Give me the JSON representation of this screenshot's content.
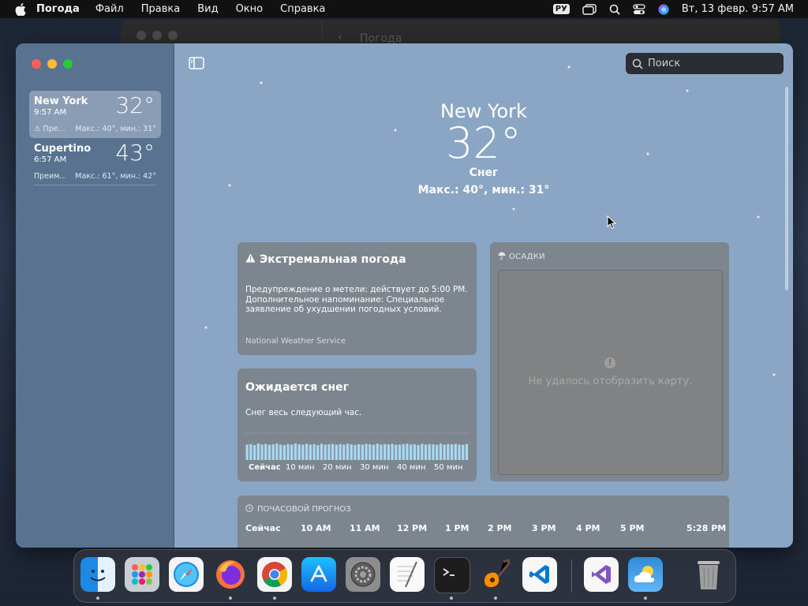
{
  "menubar": {
    "app_name": "Погода",
    "items": [
      "Файл",
      "Правка",
      "Вид",
      "Окно",
      "Справка"
    ],
    "keyboard_layout": "РУ",
    "clock": "Вт, 13 февр.  9:57 AM"
  },
  "background_window": {
    "title": "Погода"
  },
  "search": {
    "placeholder": "Поиск"
  },
  "sidebar": {
    "cities": [
      {
        "name": "New York",
        "time": "9:57 AM",
        "temp": "32°",
        "condition": "Пре...",
        "range": "Макс.: 40°, мин.: 31°",
        "selected": true,
        "alert": true
      },
      {
        "name": "Cupertino",
        "time": "6:57 AM",
        "temp": "43°",
        "condition": "Преим...",
        "range": "Макс.: 61°, мин.: 42°",
        "selected": false,
        "alert": false
      }
    ]
  },
  "current": {
    "city": "New York",
    "temp": "32°",
    "condition": "Снег",
    "hilo": "Макс.: 40°, мин.: 31°"
  },
  "alert_card": {
    "title": "Экстремальная погода",
    "body": "Предупреждение о метели: действует до 5:00 PM. Дополнительное напоминание: Специальное заявление об ухудшении погодных условий.",
    "source": "National Weather Service"
  },
  "snow_card": {
    "title": "Ожидается снег",
    "body": "Снег весь следующий час.",
    "axis": [
      "Сейчас",
      "10 мин",
      "20 мин",
      "30 мин",
      "40 мин",
      "50 мин"
    ],
    "intensity": [
      0.7,
      0.72,
      0.68,
      0.75,
      0.7,
      0.73,
      0.69,
      0.71,
      0.74,
      0.7,
      0.68,
      0.72,
      0.7,
      0.75,
      0.71,
      0.69,
      0.73,
      0.7,
      0.72,
      0.68,
      0.74,
      0.7,
      0.71,
      0.73,
      0.69,
      0.72,
      0.7,
      0.74,
      0.71,
      0.68,
      0.72,
      0.7,
      0.73,
      0.71,
      0.69,
      0.74,
      0.7,
      0.72,
      0.71,
      0.73,
      0.69,
      0.7,
      0.72,
      0.74,
      0.7,
      0.71,
      0.68,
      0.73,
      0.7,
      0.72,
      0.71,
      0.69,
      0.74,
      0.7,
      0.72,
      0.71,
      0.73,
      0.7,
      0.69,
      0.72
    ]
  },
  "precip_card": {
    "header": "ОСАДКИ",
    "error": "Не удалось отобразить карту."
  },
  "hourly_card": {
    "header": "ПОЧАСОВОЙ ПРОГНОЗ",
    "hours": [
      "Сейчас",
      "10 AM",
      "11 AM",
      "12 PM",
      "1 PM",
      "2 PM",
      "3 PM",
      "4 PM",
      "5 PM",
      "5:28 PM"
    ]
  },
  "dock": {
    "apps": [
      "finder",
      "launchpad",
      "safari",
      "firefox",
      "chrome",
      "app-store",
      "system-settings",
      "textedit",
      "terminal",
      "garageband",
      "vscode",
      "visual-studio",
      "weather",
      "trash"
    ]
  },
  "colors": {
    "sidebar": "#587290",
    "content": "#8aa6c4",
    "card": "#787878",
    "close": "#ff5f57",
    "minimize": "#febc2e",
    "zoom": "#28c840"
  }
}
